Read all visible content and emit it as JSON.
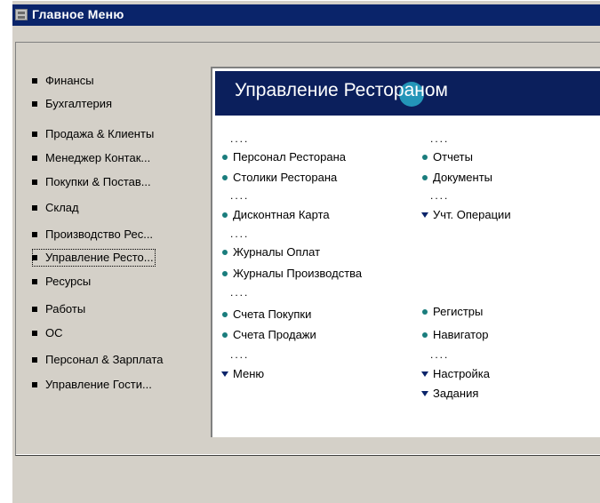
{
  "window": {
    "title": "Главное Меню",
    "icon": "form-icon"
  },
  "nav": {
    "items": [
      {
        "label": "Финансы"
      },
      {
        "label": "Бухгалтерия"
      },
      {
        "label": "Продажа & Клиенты"
      },
      {
        "label": "Менеджер Контак..."
      },
      {
        "label": "Покупки & Постав..."
      },
      {
        "label": "Склад"
      },
      {
        "label": "Производство Рес..."
      },
      {
        "label": "Управление Ресто...",
        "selected": true
      },
      {
        "label": "Ресурсы"
      },
      {
        "label": "Работы"
      },
      {
        "label": "ОС"
      },
      {
        "label": "Персонал & Зарплата"
      },
      {
        "label": "Управление Гости..."
      }
    ]
  },
  "panel": {
    "header": "Управление Ресторанoм",
    "separator": "....",
    "left_links": {
      "staff": "Персонал Ресторана",
      "tables": "Столики Ресторана",
      "discount": "Дисконтная Карта",
      "payment_journals": "Журналы Оплат",
      "production_journals": "Журналы Производства",
      "purchase_invoices": "Счета Покупки",
      "sales_invoices": "Счета Продажи",
      "menu": "Меню"
    },
    "right_links": {
      "reports": "Отчеты",
      "documents": "Документы",
      "accounting_ops": "Учт. Операции",
      "registers": "Регистры",
      "navigator": "Навигатор",
      "settings": "Настройка",
      "tasks": "Задания"
    }
  },
  "colors": {
    "titlebar": "#0a246a",
    "panel_header": "#0b1f5c",
    "bullet_teal": "#1a7d7d",
    "window_bg": "#d4d0c8"
  }
}
